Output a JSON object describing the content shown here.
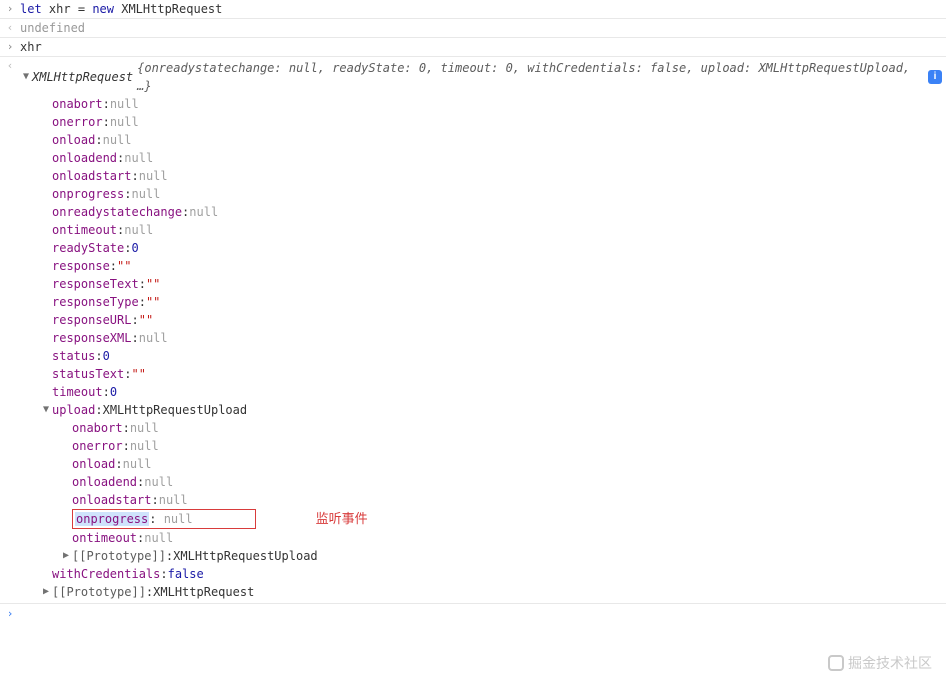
{
  "input1": {
    "let": "let",
    "var": "xhr",
    "eq": "=",
    "new": "new",
    "cls": "XMLHttpRequest"
  },
  "result1": "undefined",
  "input2": "xhr",
  "summary": {
    "cls": "XMLHttpRequest",
    "body": "{onreadystatechange: null, readyState: 0, timeout: 0, withCredentials: false, upload: XMLHttpRequestUpload, …}",
    "info": "i"
  },
  "props": [
    {
      "k": "onabort",
      "v": "null",
      "t": "null"
    },
    {
      "k": "onerror",
      "v": "null",
      "t": "null"
    },
    {
      "k": "onload",
      "v": "null",
      "t": "null"
    },
    {
      "k": "onloadend",
      "v": "null",
      "t": "null"
    },
    {
      "k": "onloadstart",
      "v": "null",
      "t": "null"
    },
    {
      "k": "onprogress",
      "v": "null",
      "t": "null"
    },
    {
      "k": "onreadystatechange",
      "v": "null",
      "t": "null"
    },
    {
      "k": "ontimeout",
      "v": "null",
      "t": "null"
    },
    {
      "k": "readyState",
      "v": "0",
      "t": "num"
    },
    {
      "k": "response",
      "v": "\"\"",
      "t": "str"
    },
    {
      "k": "responseText",
      "v": "\"\"",
      "t": "str"
    },
    {
      "k": "responseType",
      "v": "\"\"",
      "t": "str"
    },
    {
      "k": "responseURL",
      "v": "\"\"",
      "t": "str"
    },
    {
      "k": "responseXML",
      "v": "null",
      "t": "null"
    },
    {
      "k": "status",
      "v": "0",
      "t": "num"
    },
    {
      "k": "statusText",
      "v": "\"\"",
      "t": "str"
    },
    {
      "k": "timeout",
      "v": "0",
      "t": "num"
    }
  ],
  "upload": {
    "k": "upload",
    "v": "XMLHttpRequestUpload",
    "props": [
      {
        "k": "onabort",
        "v": "null",
        "t": "null"
      },
      {
        "k": "onerror",
        "v": "null",
        "t": "null"
      },
      {
        "k": "onload",
        "v": "null",
        "t": "null"
      },
      {
        "k": "onloadend",
        "v": "null",
        "t": "null"
      },
      {
        "k": "onloadstart",
        "v": "null",
        "t": "null"
      },
      {
        "k": "onprogress",
        "v": "null",
        "t": "null",
        "hl": true,
        "annotation": "监听事件"
      },
      {
        "k": "ontimeout",
        "v": "null",
        "t": "null"
      }
    ],
    "proto": {
      "k": "[[Prototype]]",
      "v": "XMLHttpRequestUpload"
    }
  },
  "withCredentials": {
    "k": "withCredentials",
    "v": "false",
    "t": "bool"
  },
  "proto": {
    "k": "[[Prototype]]",
    "v": "XMLHttpRequest"
  },
  "watermark": "掘金技术社区"
}
